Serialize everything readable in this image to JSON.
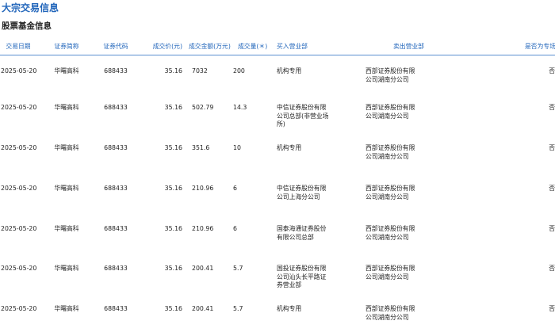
{
  "page_title": "大宗交易信息",
  "section_title": "股票基金信息",
  "columns": {
    "date": "交易日期",
    "name": "证券简称",
    "code": "证券代码",
    "price": "成交价(元)",
    "amount": "成交金额(万元)",
    "volume": "成交量(＊)",
    "buyer": "买入营业部",
    "seller": "卖出营业部",
    "flag": "是否为专场"
  },
  "rows": [
    {
      "date": "2025-05-20",
      "name": "华曙高科",
      "code": "688433",
      "price": "35.16",
      "amount": "7032",
      "volume": "200",
      "buyer": "机构专用",
      "seller": "西部证券股份有限公司湖南分公司",
      "flag": "否"
    },
    {
      "date": "2025-05-20",
      "name": "华曙高科",
      "code": "688433",
      "price": "35.16",
      "amount": "502.79",
      "volume": "14.3",
      "buyer": "中信证券股份有限公司总部(非营业场所)",
      "seller": "西部证券股份有限公司湖南分公司",
      "flag": "否"
    },
    {
      "date": "2025-05-20",
      "name": "华曙高科",
      "code": "688433",
      "price": "35.16",
      "amount": "351.6",
      "volume": "10",
      "buyer": "机构专用",
      "seller": "西部证券股份有限公司湖南分公司",
      "flag": "否"
    },
    {
      "date": "2025-05-20",
      "name": "华曙高科",
      "code": "688433",
      "price": "35.16",
      "amount": "210.96",
      "volume": "6",
      "buyer": "中信证券股份有限公司上海分公司",
      "seller": "西部证券股份有限公司湖南分公司",
      "flag": "否"
    },
    {
      "date": "2025-05-20",
      "name": "华曙高科",
      "code": "688433",
      "price": "35.16",
      "amount": "210.96",
      "volume": "6",
      "buyer": "国泰海通证券股份有限公司总部",
      "seller": "西部证券股份有限公司湖南分公司",
      "flag": "否"
    },
    {
      "date": "2025-05-20",
      "name": "华曙高科",
      "code": "688433",
      "price": "35.16",
      "amount": "200.41",
      "volume": "5.7",
      "buyer": "国投证券股份有限公司汕头长平路证券营业部",
      "seller": "西部证券股份有限公司湖南分公司",
      "flag": "否"
    },
    {
      "date": "2025-05-20",
      "name": "华曙高科",
      "code": "688433",
      "price": "35.16",
      "amount": "200.41",
      "volume": "5.7",
      "buyer": "机构专用",
      "seller": "西部证券股份有限公司湖南分公司",
      "flag": "否"
    }
  ]
}
